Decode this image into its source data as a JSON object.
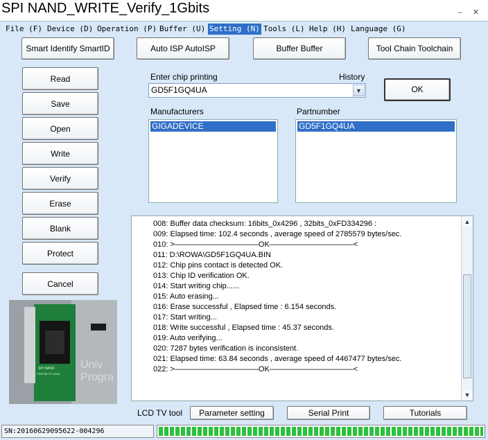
{
  "window": {
    "title": "SPI NAND_WRITE_Verify_1Gbits",
    "minimize": "–",
    "close": "✕"
  },
  "menu": [
    {
      "label": "File (F)"
    },
    {
      "label": "Device (D)"
    },
    {
      "label": "Operation (P)"
    },
    {
      "label": "Buffer (U)"
    },
    {
      "label": "Setting (N)",
      "active": true
    },
    {
      "label": "Tools (L)"
    },
    {
      "label": "Help (H)"
    },
    {
      "label": "Language (G)"
    }
  ],
  "toolbar": {
    "smart_identify": "Smart Identify SmartID",
    "auto_isp": "Auto ISP AutoISP",
    "buffer": "Buffer Buffer",
    "tool_chain": "Tool Chain Toolchain"
  },
  "side_buttons": {
    "read": "Read",
    "save": "Save",
    "open": "Open",
    "write": "Write",
    "verify": "Verify",
    "erase": "Erase",
    "blank": "Blank",
    "protect": "Protect",
    "cancel": "Cancel"
  },
  "chip": {
    "enter_label": "Enter chip printing",
    "history_label": "History",
    "value": "GD5F1GQ4UA",
    "ok": "OK"
  },
  "manufacturers": {
    "label": "Manufacturers",
    "selected": "GIGADEVICE"
  },
  "partnumber": {
    "label": "Partnumber",
    "selected": "GD5F1GQ4UA"
  },
  "photo": {
    "board_text_1": "SPI NAND",
    "board_text_2": "TSOP48-TF-128-B",
    "bg_text_1": "Univ",
    "bg_text_2": "Progra"
  },
  "log": [
    {
      "n": "008:",
      "text": "Buffer data checksum: 16bits_0x4296 , 32bits_0xFD334296 :"
    },
    {
      "n": "009:",
      "text": "Elapsed time: 102.4 seconds , average speed of 2785579 bytes/sec."
    },
    {
      "n": "010:",
      "text": ">———————————OK———————————<"
    },
    {
      "n": "011:",
      "text": "D:\\ROWA\\GD5F1GQ4UA.BIN"
    },
    {
      "n": "012:",
      "text": "Chip pins contact is detected OK."
    },
    {
      "n": "013:",
      "text": "Chip ID verification OK."
    },
    {
      "n": "014:",
      "text": "Start writing chip......"
    },
    {
      "n": "015:",
      "text": "Auto erasing..."
    },
    {
      "n": "016:",
      "text": "Erase successful , Elapsed time : 6.154 seconds."
    },
    {
      "n": "017:",
      "text": "Start writing..."
    },
    {
      "n": "018:",
      "text": "Write successful , Elapsed time : 45.37 seconds."
    },
    {
      "n": "019:",
      "text": "Auto verifying..."
    },
    {
      "n": "020:",
      "text": "7287 bytes verification is inconsistent."
    },
    {
      "n": "021:",
      "text": "Elapsed time: 63.84 seconds , average speed of 4467477 bytes/sec."
    },
    {
      "n": "022:",
      "text": ">———————————OK———————————<"
    }
  ],
  "bottom": {
    "lcd_label": "LCD TV tool",
    "parameter_setting": "Parameter setting",
    "serial_print": "Serial Print",
    "tutorials": "Tutorials"
  },
  "status": {
    "sn": "SN:20160629095622-004296",
    "progress_fraction": 1.0
  },
  "colors": {
    "client_bg": "#d8e8f8",
    "selection": "#2f6fc8",
    "progress": "#2cc13c"
  }
}
